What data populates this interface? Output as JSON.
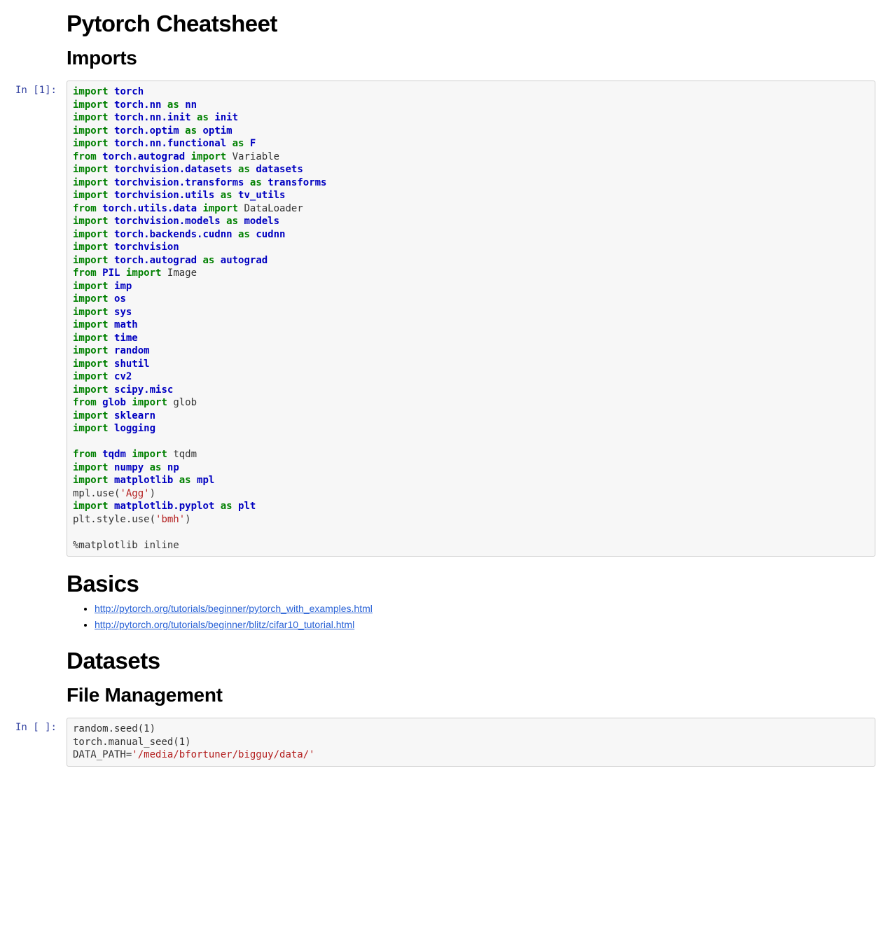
{
  "cells": [
    {
      "type": "text",
      "headings": [
        {
          "level": "h1",
          "text": "Pytorch Cheatsheet"
        },
        {
          "level": "h2",
          "text": "Imports"
        }
      ]
    },
    {
      "type": "code",
      "prompt": "In [1]:",
      "lines": [
        [
          [
            "kw",
            "import"
          ],
          [
            "pl",
            " "
          ],
          [
            "nm",
            "torch"
          ]
        ],
        [
          [
            "kw",
            "import"
          ],
          [
            "pl",
            " "
          ],
          [
            "nm",
            "torch.nn"
          ],
          [
            "pl",
            " "
          ],
          [
            "kw",
            "as"
          ],
          [
            "pl",
            " "
          ],
          [
            "nm",
            "nn"
          ]
        ],
        [
          [
            "kw",
            "import"
          ],
          [
            "pl",
            " "
          ],
          [
            "nm",
            "torch.nn.init"
          ],
          [
            "pl",
            " "
          ],
          [
            "kw",
            "as"
          ],
          [
            "pl",
            " "
          ],
          [
            "nm",
            "init"
          ]
        ],
        [
          [
            "kw",
            "import"
          ],
          [
            "pl",
            " "
          ],
          [
            "nm",
            "torch.optim"
          ],
          [
            "pl",
            " "
          ],
          [
            "kw",
            "as"
          ],
          [
            "pl",
            " "
          ],
          [
            "nm",
            "optim"
          ]
        ],
        [
          [
            "kw",
            "import"
          ],
          [
            "pl",
            " "
          ],
          [
            "nm",
            "torch.nn.functional"
          ],
          [
            "pl",
            " "
          ],
          [
            "kw",
            "as"
          ],
          [
            "pl",
            " "
          ],
          [
            "nm",
            "F"
          ]
        ],
        [
          [
            "kw",
            "from"
          ],
          [
            "pl",
            " "
          ],
          [
            "nm",
            "torch.autograd"
          ],
          [
            "pl",
            " "
          ],
          [
            "kw",
            "import"
          ],
          [
            "pl",
            " Variable"
          ]
        ],
        [
          [
            "kw",
            "import"
          ],
          [
            "pl",
            " "
          ],
          [
            "nm",
            "torchvision.datasets"
          ],
          [
            "pl",
            " "
          ],
          [
            "kw",
            "as"
          ],
          [
            "pl",
            " "
          ],
          [
            "nm",
            "datasets"
          ]
        ],
        [
          [
            "kw",
            "import"
          ],
          [
            "pl",
            " "
          ],
          [
            "nm",
            "torchvision.transforms"
          ],
          [
            "pl",
            " "
          ],
          [
            "kw",
            "as"
          ],
          [
            "pl",
            " "
          ],
          [
            "nm",
            "transforms"
          ]
        ],
        [
          [
            "kw",
            "import"
          ],
          [
            "pl",
            " "
          ],
          [
            "nm",
            "torchvision.utils"
          ],
          [
            "pl",
            " "
          ],
          [
            "kw",
            "as"
          ],
          [
            "pl",
            " "
          ],
          [
            "nm",
            "tv_utils"
          ]
        ],
        [
          [
            "kw",
            "from"
          ],
          [
            "pl",
            " "
          ],
          [
            "nm",
            "torch.utils.data"
          ],
          [
            "pl",
            " "
          ],
          [
            "kw",
            "import"
          ],
          [
            "pl",
            " DataLoader"
          ]
        ],
        [
          [
            "kw",
            "import"
          ],
          [
            "pl",
            " "
          ],
          [
            "nm",
            "torchvision.models"
          ],
          [
            "pl",
            " "
          ],
          [
            "kw",
            "as"
          ],
          [
            "pl",
            " "
          ],
          [
            "nm",
            "models"
          ]
        ],
        [
          [
            "kw",
            "import"
          ],
          [
            "pl",
            " "
          ],
          [
            "nm",
            "torch.backends.cudnn"
          ],
          [
            "pl",
            " "
          ],
          [
            "kw",
            "as"
          ],
          [
            "pl",
            " "
          ],
          [
            "nm",
            "cudnn"
          ]
        ],
        [
          [
            "kw",
            "import"
          ],
          [
            "pl",
            " "
          ],
          [
            "nm",
            "torchvision"
          ]
        ],
        [
          [
            "kw",
            "import"
          ],
          [
            "pl",
            " "
          ],
          [
            "nm",
            "torch.autograd"
          ],
          [
            "pl",
            " "
          ],
          [
            "kw",
            "as"
          ],
          [
            "pl",
            " "
          ],
          [
            "nm",
            "autograd"
          ]
        ],
        [
          [
            "kw",
            "from"
          ],
          [
            "pl",
            " "
          ],
          [
            "nm",
            "PIL"
          ],
          [
            "pl",
            " "
          ],
          [
            "kw",
            "import"
          ],
          [
            "pl",
            " Image"
          ]
        ],
        [
          [
            "kw",
            "import"
          ],
          [
            "pl",
            " "
          ],
          [
            "nm",
            "imp"
          ]
        ],
        [
          [
            "kw",
            "import"
          ],
          [
            "pl",
            " "
          ],
          [
            "nm",
            "os"
          ]
        ],
        [
          [
            "kw",
            "import"
          ],
          [
            "pl",
            " "
          ],
          [
            "nm",
            "sys"
          ]
        ],
        [
          [
            "kw",
            "import"
          ],
          [
            "pl",
            " "
          ],
          [
            "nm",
            "math"
          ]
        ],
        [
          [
            "kw",
            "import"
          ],
          [
            "pl",
            " "
          ],
          [
            "nm",
            "time"
          ]
        ],
        [
          [
            "kw",
            "import"
          ],
          [
            "pl",
            " "
          ],
          [
            "nm",
            "random"
          ]
        ],
        [
          [
            "kw",
            "import"
          ],
          [
            "pl",
            " "
          ],
          [
            "nm",
            "shutil"
          ]
        ],
        [
          [
            "kw",
            "import"
          ],
          [
            "pl",
            " "
          ],
          [
            "nm",
            "cv2"
          ]
        ],
        [
          [
            "kw",
            "import"
          ],
          [
            "pl",
            " "
          ],
          [
            "nm",
            "scipy.misc"
          ]
        ],
        [
          [
            "kw",
            "from"
          ],
          [
            "pl",
            " "
          ],
          [
            "nm",
            "glob"
          ],
          [
            "pl",
            " "
          ],
          [
            "kw",
            "import"
          ],
          [
            "pl",
            " glob"
          ]
        ],
        [
          [
            "kw",
            "import"
          ],
          [
            "pl",
            " "
          ],
          [
            "nm",
            "sklearn"
          ]
        ],
        [
          [
            "kw",
            "import"
          ],
          [
            "pl",
            " "
          ],
          [
            "nm",
            "logging"
          ]
        ],
        [
          [
            "pl",
            ""
          ]
        ],
        [
          [
            "kw",
            "from"
          ],
          [
            "pl",
            " "
          ],
          [
            "nm",
            "tqdm"
          ],
          [
            "pl",
            " "
          ],
          [
            "kw",
            "import"
          ],
          [
            "pl",
            " tqdm"
          ]
        ],
        [
          [
            "kw",
            "import"
          ],
          [
            "pl",
            " "
          ],
          [
            "nm",
            "numpy"
          ],
          [
            "pl",
            " "
          ],
          [
            "kw",
            "as"
          ],
          [
            "pl",
            " "
          ],
          [
            "nm",
            "np"
          ]
        ],
        [
          [
            "kw",
            "import"
          ],
          [
            "pl",
            " "
          ],
          [
            "nm",
            "matplotlib"
          ],
          [
            "pl",
            " "
          ],
          [
            "kw",
            "as"
          ],
          [
            "pl",
            " "
          ],
          [
            "nm",
            "mpl"
          ]
        ],
        [
          [
            "pl",
            "mpl.use("
          ],
          [
            "st",
            "'Agg'"
          ],
          [
            "pl",
            ")"
          ]
        ],
        [
          [
            "kw",
            "import"
          ],
          [
            "pl",
            " "
          ],
          [
            "nm",
            "matplotlib.pyplot"
          ],
          [
            "pl",
            " "
          ],
          [
            "kw",
            "as"
          ],
          [
            "pl",
            " "
          ],
          [
            "nm",
            "plt"
          ]
        ],
        [
          [
            "pl",
            "plt.style.use("
          ],
          [
            "st",
            "'bmh'"
          ],
          [
            "pl",
            ")"
          ]
        ],
        [
          [
            "pl",
            ""
          ]
        ],
        [
          [
            "pl",
            "%matplotlib inline"
          ]
        ]
      ]
    },
    {
      "type": "text",
      "headings": [
        {
          "level": "h1",
          "text": "Basics"
        }
      ],
      "links": [
        "http://pytorch.org/tutorials/beginner/pytorch_with_examples.html",
        "http://pytorch.org/tutorials/beginner/blitz/cifar10_tutorial.html"
      ]
    },
    {
      "type": "text",
      "headings": [
        {
          "level": "h1",
          "text": "Datasets"
        },
        {
          "level": "h2",
          "text": "File Management"
        }
      ]
    },
    {
      "type": "code",
      "prompt": "In [ ]:",
      "lines": [
        [
          [
            "pl",
            "random.seed(1)"
          ]
        ],
        [
          [
            "pl",
            "torch.manual_seed(1)"
          ]
        ],
        [
          [
            "pl",
            "DATA_PATH="
          ],
          [
            "st",
            "'/media/bfortuner/bigguy/data/'"
          ]
        ]
      ]
    }
  ]
}
